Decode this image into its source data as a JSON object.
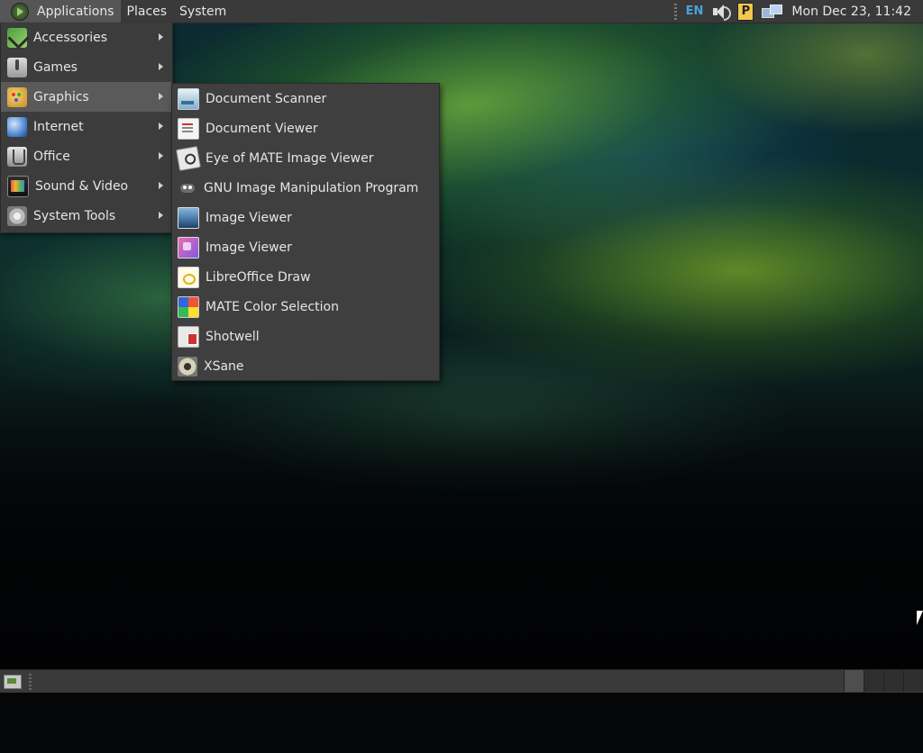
{
  "top_panel": {
    "menus": [
      {
        "label": "Applications",
        "active": true
      },
      {
        "label": "Places",
        "active": false
      },
      {
        "label": "System",
        "active": false
      }
    ],
    "tray": {
      "keyboard_layout": "EN",
      "volume_icon": "volume-icon",
      "indicator_icon": "parking-indicator-icon",
      "network_icon": "network-icon",
      "clock": "Mon Dec 23, 11:42"
    }
  },
  "applications_menu": {
    "items": [
      {
        "label": "Accessories",
        "icon": "accessories-icon",
        "has_submenu": true,
        "highlighted": false
      },
      {
        "label": "Games",
        "icon": "games-icon",
        "has_submenu": true,
        "highlighted": false
      },
      {
        "label": "Graphics",
        "icon": "graphics-icon",
        "has_submenu": true,
        "highlighted": true
      },
      {
        "label": "Internet",
        "icon": "internet-icon",
        "has_submenu": true,
        "highlighted": false
      },
      {
        "label": "Office",
        "icon": "office-icon",
        "has_submenu": true,
        "highlighted": false
      },
      {
        "label": "Sound & Video",
        "icon": "sound-video-icon",
        "has_submenu": true,
        "highlighted": false
      },
      {
        "label": "System Tools",
        "icon": "system-tools-icon",
        "has_submenu": true,
        "highlighted": false
      }
    ]
  },
  "graphics_submenu": {
    "items": [
      {
        "label": "Document Scanner",
        "icon": "document-scanner-icon"
      },
      {
        "label": "Document Viewer",
        "icon": "document-viewer-icon"
      },
      {
        "label": "Eye of MATE Image Viewer",
        "icon": "eye-of-mate-icon"
      },
      {
        "label": "GNU Image Manipulation Program",
        "icon": "gimp-icon"
      },
      {
        "label": "Image Viewer",
        "icon": "image-viewer-icon"
      },
      {
        "label": "Image Viewer",
        "icon": "image-viewer-alt-icon"
      },
      {
        "label": "LibreOffice Draw",
        "icon": "libreoffice-draw-icon"
      },
      {
        "label": "MATE Color Selection",
        "icon": "color-selection-icon"
      },
      {
        "label": "Shotwell",
        "icon": "shotwell-icon"
      },
      {
        "label": "XSane",
        "icon": "xsane-icon"
      }
    ]
  },
  "bottom_panel": {
    "show_desktop_icon": "show-desktop-icon",
    "workspaces": [
      {
        "active": true
      },
      {
        "active": false
      },
      {
        "active": false
      },
      {
        "active": false
      }
    ]
  },
  "colors": {
    "panel_bg": "#3a3a3a",
    "menu_bg": "#3c3c3c",
    "highlight_bg": "#5a5a5a",
    "keyboard_layout_accent": "#4aa3e0"
  }
}
